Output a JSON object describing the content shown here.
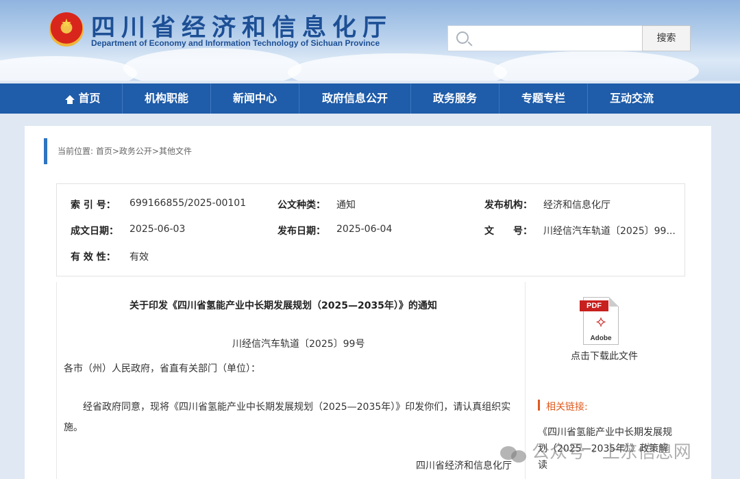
{
  "header": {
    "title": "四川省经济和信息化厅",
    "subtitle": "Department of Economy and Information Technology of Sichuan Province",
    "search_placeholder": "",
    "search_button": "搜索"
  },
  "nav": {
    "items": [
      "首页",
      "机构职能",
      "新闻中心",
      "政府信息公开",
      "政务服务",
      "专题专栏",
      "互动交流"
    ]
  },
  "breadcrumb": "当前位置: 首页>政务公开>其他文件",
  "info": {
    "index_label": "索 引 号：",
    "index_value": "699166855/2025-00101",
    "type_label": "公文种类：",
    "type_value": "通知",
    "org_label": "发布机构：",
    "org_value": "经济和信息化厅",
    "created_label": "成文日期：",
    "created_value": "2025-06-03",
    "published_label": "发布日期：",
    "published_value": "2025-06-04",
    "docno_label": "文　　号：",
    "docno_value": "川经信汽车轨道〔2025〕99...",
    "valid_label": "有 效 性：",
    "valid_value": "有效"
  },
  "document": {
    "title": "关于印发《四川省氢能产业中长期发展规划（2025—2035年）》的通知",
    "number": "川经信汽车轨道〔2025〕99号",
    "salutation": "各市（州）人民政府，省直有关部门（单位）：",
    "body": "经省政府同意，现将《四川省氢能产业中长期发展规划（2025—2035年）》印发你们，请认真组织实施。",
    "signature": "四川省经济和信息化厅"
  },
  "sidebar": {
    "pdf_tag": "PDF",
    "pdf_brand": "Adobe",
    "download_label": "点击下载此文件",
    "related_title": "相关链接:",
    "related_link": "《四川省氢能产业中长期发展规划（2025—2035年）》政策解读"
  },
  "watermark": "公众号 · 上东信息网"
}
